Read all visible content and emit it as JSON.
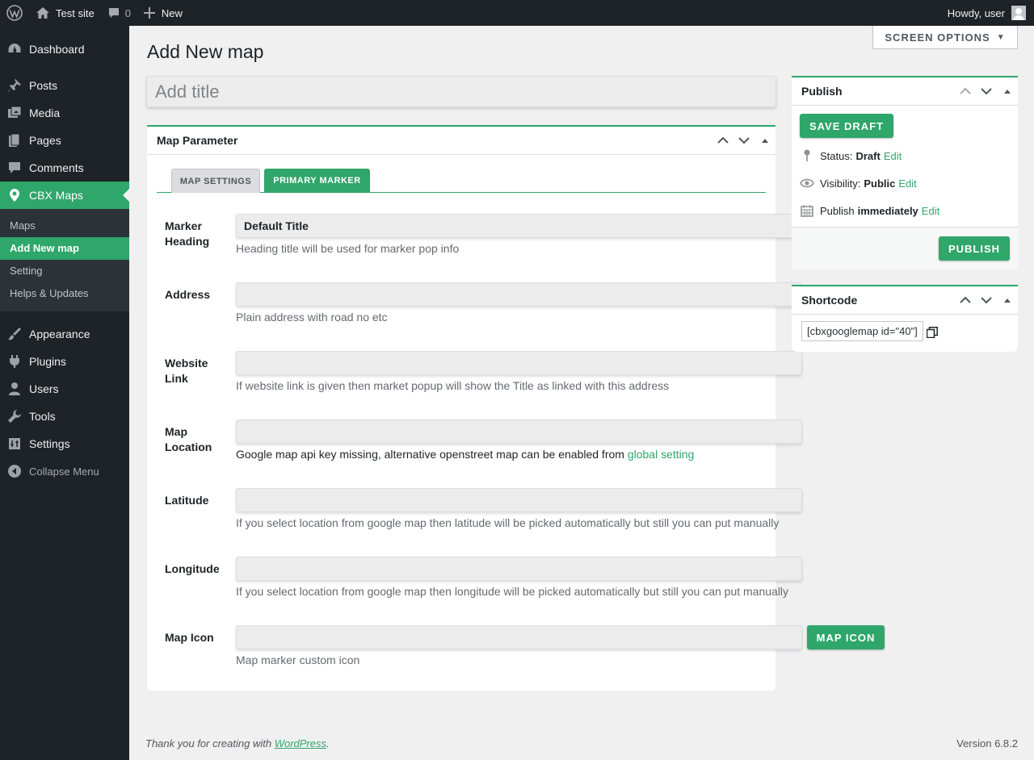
{
  "adminbar": {
    "site_name": "Test site",
    "comments_count": "0",
    "new_label": "New",
    "greeting": "Howdy, user"
  },
  "sidebar": {
    "items": [
      {
        "label": "Dashboard",
        "icon": "dashboard-icon"
      },
      {
        "label": "Posts",
        "icon": "pushpin-icon"
      },
      {
        "label": "Media",
        "icon": "media-icon"
      },
      {
        "label": "Pages",
        "icon": "pages-icon"
      },
      {
        "label": "Comments",
        "icon": "comment-icon"
      },
      {
        "label": "CBX Maps",
        "icon": "location-pin-icon"
      },
      {
        "label": "Appearance",
        "icon": "paintbrush-icon"
      },
      {
        "label": "Plugins",
        "icon": "plugin-icon"
      },
      {
        "label": "Users",
        "icon": "user-icon"
      },
      {
        "label": "Tools",
        "icon": "wrench-icon"
      },
      {
        "label": "Settings",
        "icon": "settings-icon"
      }
    ],
    "submenu": [
      "Maps",
      "Add New map",
      "Setting",
      "Helps & Updates"
    ],
    "collapse_label": "Collapse Menu"
  },
  "screen_options_label": "SCREEN OPTIONS",
  "page_title": "Add New map",
  "title_placeholder": "Add title",
  "map_parameter": {
    "title": "Map Parameter",
    "tabs": [
      "MAP SETTINGS",
      "PRIMARY MARKER"
    ],
    "active_tab": "PRIMARY MARKER",
    "fields": [
      {
        "label": "Marker Heading",
        "value": "Default Title",
        "desc": "Heading title will be used for marker pop info"
      },
      {
        "label": "Address",
        "value": "",
        "desc": "Plain address with road no etc"
      },
      {
        "label": "Website Link",
        "value": "",
        "desc": "If website link is given then market popup will show the Title as linked with this address"
      },
      {
        "label": "Map Location",
        "value": "",
        "desc": "Google map api key missing, alternative openstreet map can be enabled from",
        "link": "global setting"
      },
      {
        "label": "Latitude",
        "value": "",
        "desc": "If you select location from google map then latitude will be picked automatically but still you can put manually"
      },
      {
        "label": "Longitude",
        "value": "",
        "desc": "If you select location from google map then longitude will be picked automatically but still you can put manually"
      },
      {
        "label": "Map Icon",
        "value": "",
        "desc": "Map marker custom icon",
        "button": "MAP ICON"
      }
    ]
  },
  "publish": {
    "title": "Publish",
    "save_draft": "SAVE DRAFT",
    "status_label": "Status:",
    "status_value": "Draft",
    "visibility_label": "Visibility:",
    "visibility_value": "Public",
    "schedule_label": "Publish",
    "schedule_value": "immediately",
    "edit": "Edit",
    "publish_button": "PUBLISH"
  },
  "shortcode": {
    "title": "Shortcode",
    "value": "[cbxgooglemap id=\"40\"]"
  },
  "footer": {
    "thanks_prefix": "Thank you for creating with",
    "thanks_link": "WordPress",
    "thanks_suffix": ".",
    "version": "Version 6.8.2"
  },
  "colors": {
    "accent": "#2fa66a",
    "admin_dark": "#1d2327",
    "submenu_bg": "#2c3338",
    "page_bg": "#f0f0f1"
  }
}
